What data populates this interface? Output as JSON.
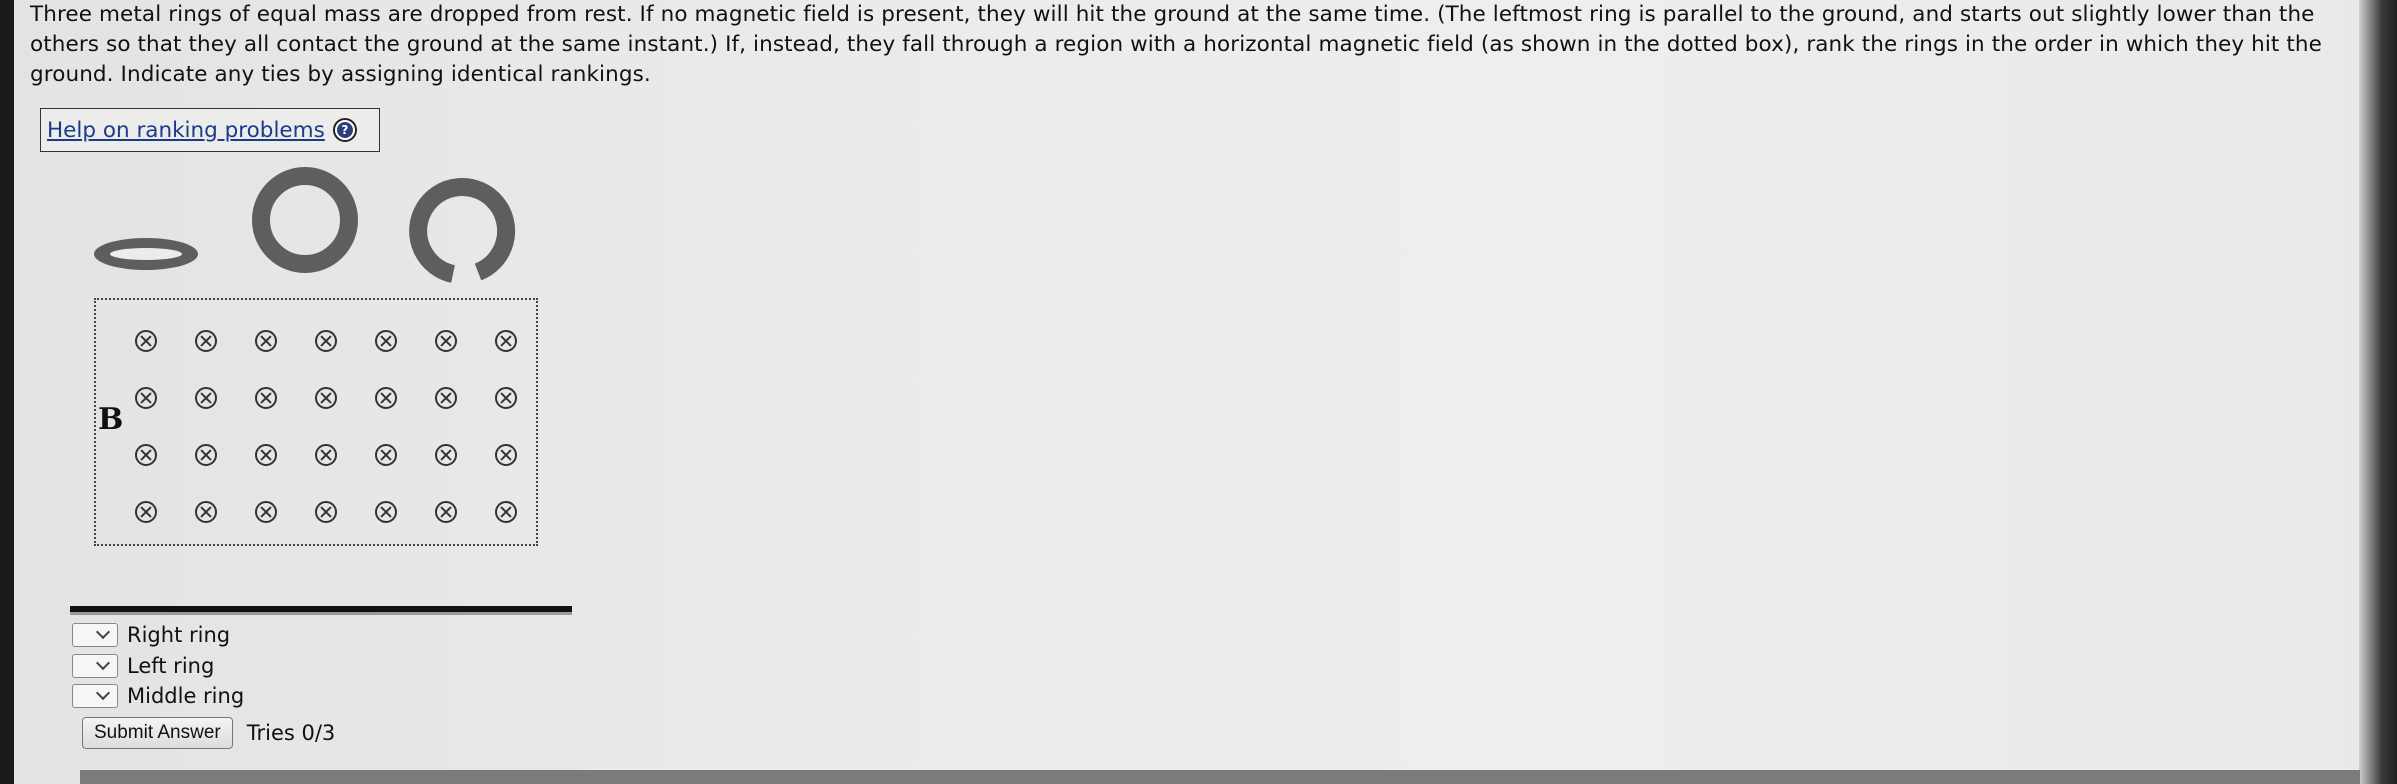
{
  "question": {
    "text": "Three metal rings of equal mass are dropped from rest. If no magnetic field is present, they will hit the ground at the same time. (The leftmost ring is parallel to the ground, and starts out slightly lower than the others so that they all contact the ground at the same instant.) If, instead, they fall through a region with a horizontal magnetic field (as shown in the dotted box), rank the rings in the order in which they hit the ground. Indicate any ties by assigning identical rankings."
  },
  "help": {
    "link_label": "Help on ranking problems",
    "icon": "help-circle-icon"
  },
  "figure": {
    "rings": [
      "horizontal-ring",
      "closed-vertical-ring",
      "split-vertical-ring"
    ],
    "field_label": "B",
    "field_symbol": "into-page-x",
    "field_rows": 4,
    "field_cols": 7
  },
  "ranking": {
    "items": [
      {
        "label": "Right ring",
        "value": ""
      },
      {
        "label": "Left ring",
        "value": ""
      },
      {
        "label": "Middle ring",
        "value": ""
      }
    ]
  },
  "submit": {
    "button_label": "Submit Answer",
    "tries": "Tries 0/3"
  },
  "colors": {
    "ring_fill": "#5e5e5e",
    "link": "#1c3a8c",
    "background": "#ececea"
  }
}
